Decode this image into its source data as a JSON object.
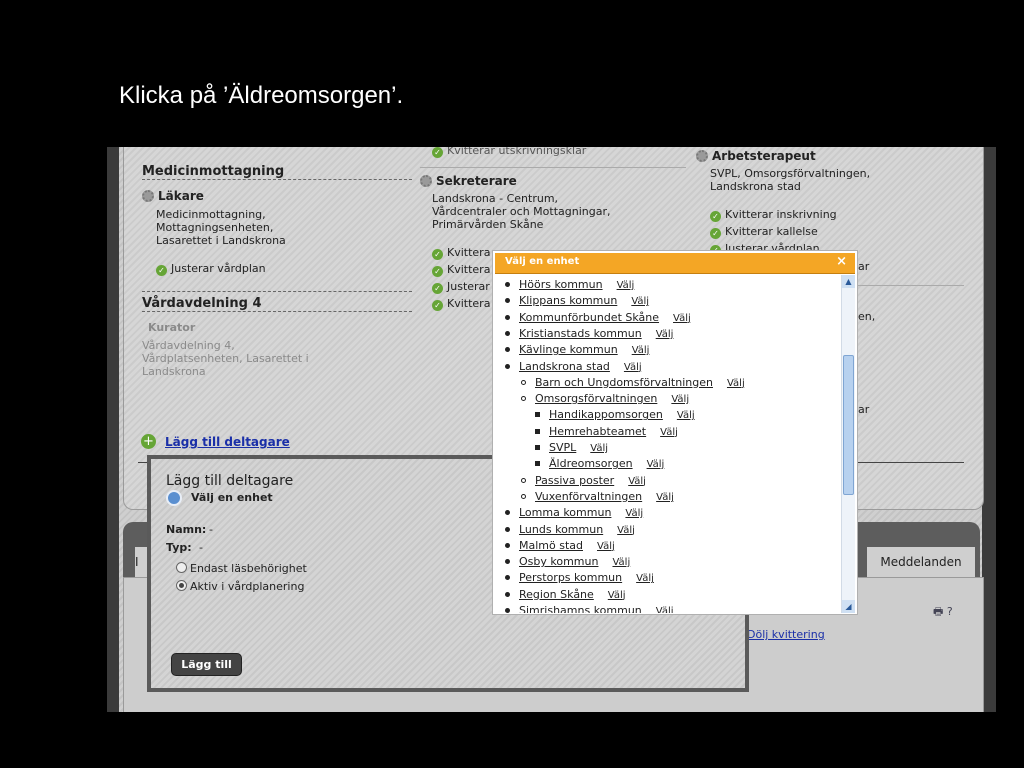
{
  "slide": {
    "title": "Klicka på ’Äldreomsorgen’."
  },
  "left_col": {
    "top_cut": "",
    "med": {
      "title": "Medicinmottagning",
      "role": "Läkare",
      "addr": [
        "Medicinmottagning,",
        "Mottagningsenheten,",
        "Lasarettet i Landskrona"
      ],
      "status": "Justerar vårdplan"
    },
    "ward": {
      "title": "Vårdavdelning 4",
      "role": "Kurator",
      "addr": [
        "Vårdavdelning 4,",
        "Vårdplatsenheten, Lasarettet i",
        "Landskrona"
      ]
    },
    "add_link": "Lägg till deltagare"
  },
  "mid_col": {
    "top_cut": "Kvitterar utskrivningsklar",
    "role": "Sekreterare",
    "addr": [
      "Landskrona - Centrum,",
      "Vårdcentraler och Mottagningar,",
      "Primärvården Skåne"
    ],
    "items": [
      "Kvittera",
      "Kvittera",
      "Justerar",
      "Kvittera"
    ]
  },
  "right_col": {
    "role": "Arbetsterapeut",
    "addr": [
      "SVPL, Omsorgsförvaltningen,",
      "Landskrona stad"
    ],
    "items": [
      "Kvitterar inskrivning",
      "Kvitterar kallelse",
      "Justerar vårdplan"
    ],
    "frag": [
      "ar",
      "en,",
      "ar"
    ]
  },
  "tabs": {
    "messages": "Meddelanden",
    "stub_left": "I",
    "stub_right": ")"
  },
  "hide_link": "Dölj kvittering",
  "dialog": {
    "title": "Lägg till deltagare",
    "subtitle": "Välj en enhet",
    "name_label": "Namn:",
    "name_val": "-",
    "type_label": "Typ:",
    "type_val": "-",
    "radio1": "Endast läsbehörighet",
    "radio2": "Aktiv i vårdplanering",
    "add_button": "Lägg till"
  },
  "popup": {
    "title": "Välj en enhet",
    "close": "×",
    "select_label": "Välj",
    "items": [
      {
        "level": 1,
        "name": "Höörs kommun"
      },
      {
        "level": 1,
        "name": "Klippans kommun"
      },
      {
        "level": 1,
        "name": "Kommunförbundet Skåne"
      },
      {
        "level": 1,
        "name": "Kristianstads kommun"
      },
      {
        "level": 1,
        "name": "Kävlinge kommun"
      },
      {
        "level": 1,
        "name": "Landskrona stad"
      },
      {
        "level": 2,
        "name": "Barn och Ungdomsförvaltningen"
      },
      {
        "level": 2,
        "name": "Omsorgsförvaltningen"
      },
      {
        "level": 3,
        "name": "Handikappomsorgen"
      },
      {
        "level": 3,
        "name": "Hemrehabteamet"
      },
      {
        "level": 3,
        "name": "SVPL"
      },
      {
        "level": 3,
        "name": "Äldreomsorgen"
      },
      {
        "level": 2,
        "name": "Passiva poster"
      },
      {
        "level": 2,
        "name": "Vuxenförvaltningen"
      },
      {
        "level": 1,
        "name": "Lomma kommun"
      },
      {
        "level": 1,
        "name": "Lunds kommun"
      },
      {
        "level": 1,
        "name": "Malmö stad"
      },
      {
        "level": 1,
        "name": "Osby kommun"
      },
      {
        "level": 1,
        "name": "Perstorps kommun"
      },
      {
        "level": 1,
        "name": "Region Skåne"
      },
      {
        "level": 1,
        "name": "Simrishamns kommun"
      }
    ]
  },
  "colors": {
    "accent_orange": "#f4a625",
    "link_blue": "#1a2fa8",
    "check_green": "#66a536"
  }
}
